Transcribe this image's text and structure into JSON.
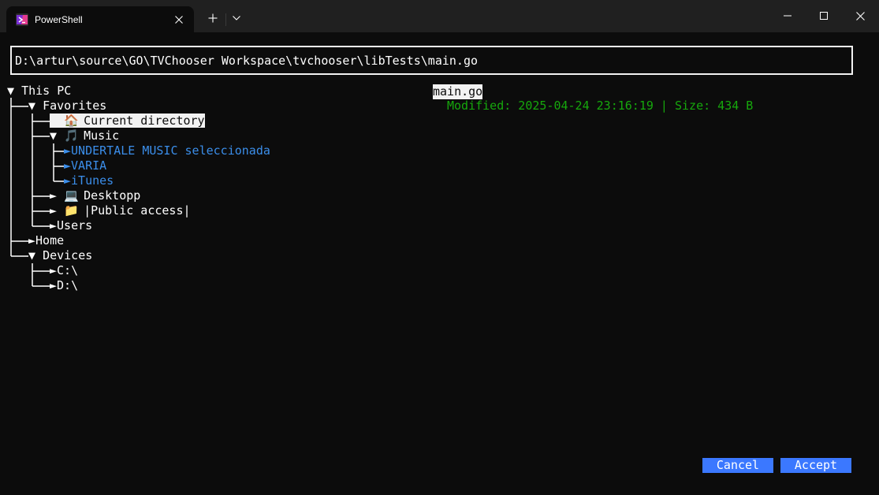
{
  "window": {
    "tab_title": "PowerShell",
    "new_tab_label": "+",
    "dropdown_icon": "chevron-down-icon",
    "controls": [
      "minimize-icon",
      "maximize-icon",
      "close-icon"
    ]
  },
  "path_input": {
    "value": "D:\\artur\\source\\GO\\TVChooser Workspace\\tvchooser\\libTests\\main.go"
  },
  "tree": {
    "root": {
      "label": "This PC",
      "expander": "▼"
    },
    "favorites": {
      "label": "Favorites",
      "expander": "▼"
    },
    "current_directory": {
      "icon": "🏠",
      "label": "Current directory"
    },
    "music": {
      "expander": "▼",
      "icon": "🎵",
      "label": "Music"
    },
    "music_children": [
      {
        "label": "UNDERTALE MUSIC seleccionada"
      },
      {
        "label": "VARIA"
      },
      {
        "label": "iTunes"
      }
    ],
    "desktop": {
      "icon": "💻",
      "label": "Desktopp"
    },
    "public": {
      "icon": "📁",
      "label": "|Public access|"
    },
    "users": {
      "label": "Users"
    },
    "home": {
      "label": "Home"
    },
    "devices": {
      "label": "Devices",
      "expander": "▼"
    },
    "drives": [
      {
        "label": "C:\\"
      },
      {
        "label": "D:\\"
      }
    ],
    "collapsed_arrow": "►"
  },
  "preview": {
    "filename": "main.go",
    "meta": "Modified: 2025-04-24 23:16:19 | Size: 434 B"
  },
  "buttons": {
    "cancel": "Cancel",
    "accept": "Accept"
  },
  "colors": {
    "background": "#0c0c0c",
    "titlebar": "#202020",
    "folder_link": "#3b8eea",
    "meta_green": "#16a80c",
    "button_blue": "#3b78ff"
  }
}
